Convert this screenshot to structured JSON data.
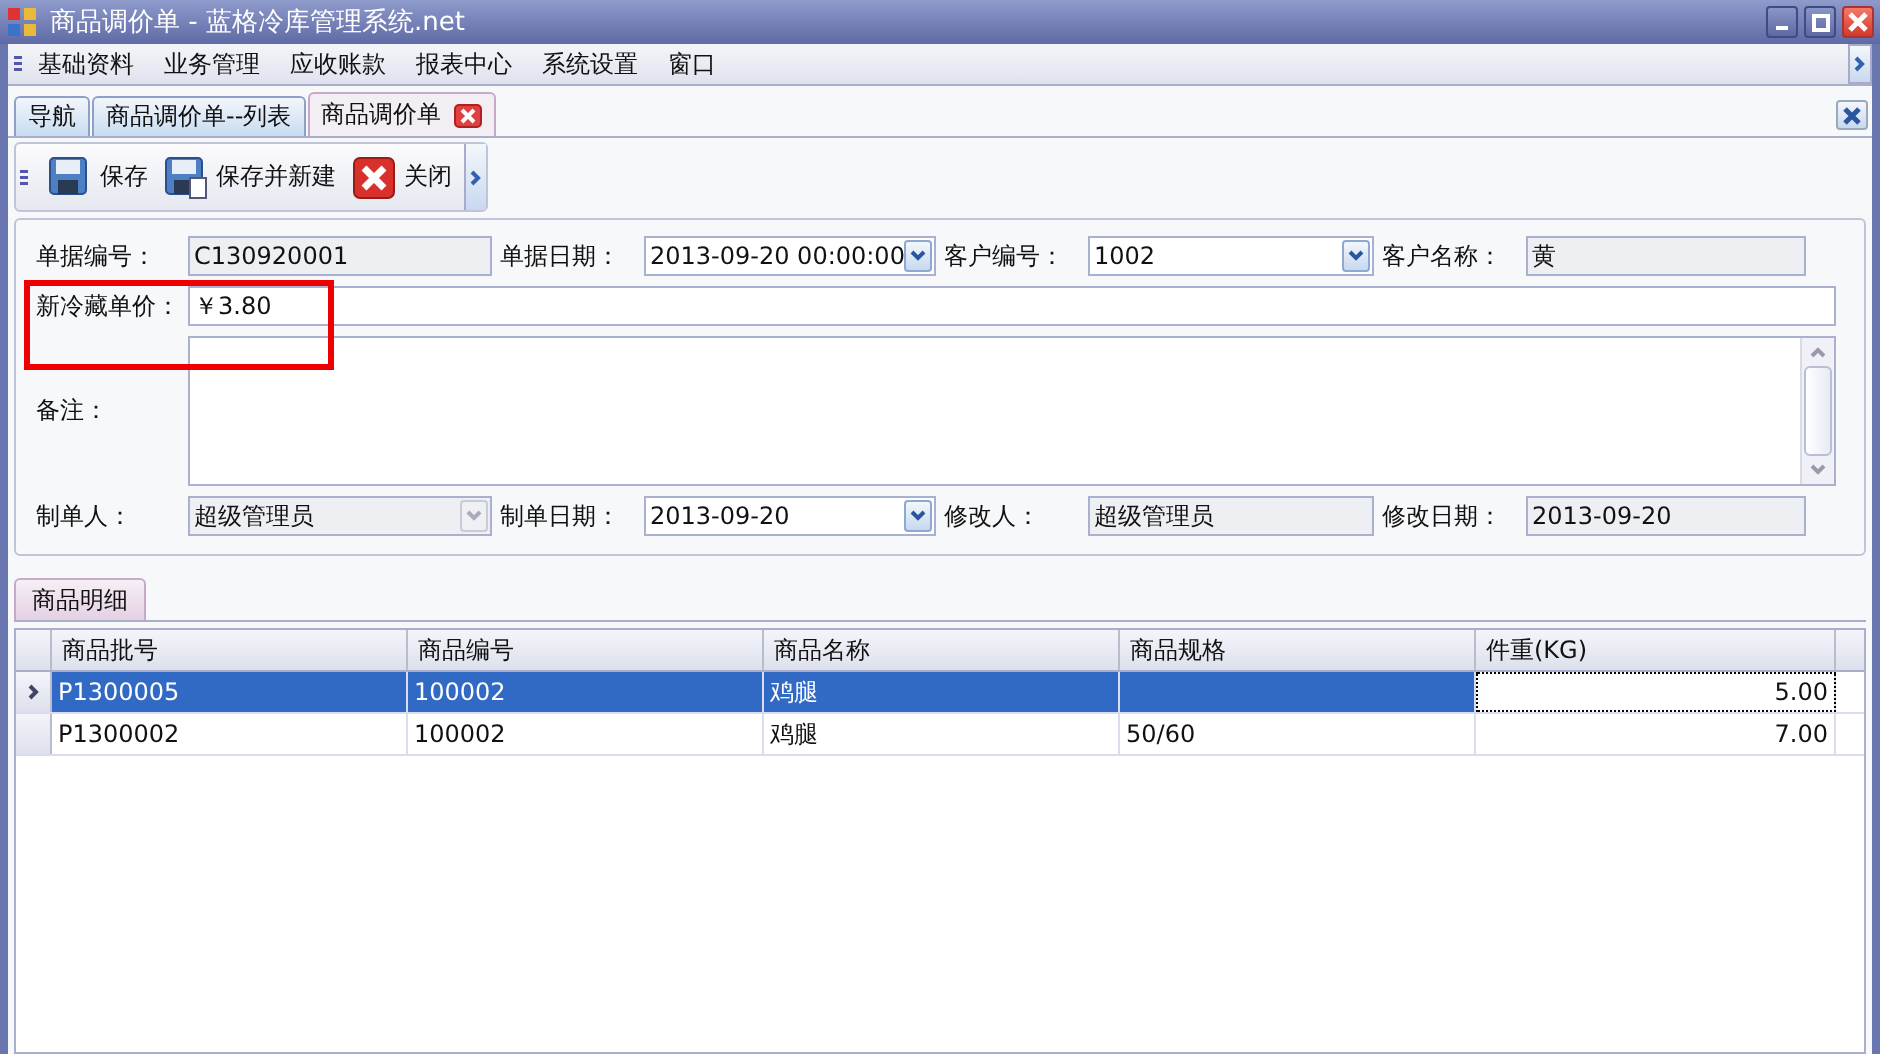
{
  "window": {
    "title": "商品调价单 - 蓝格冷库管理系统.net"
  },
  "menu": [
    "基础资料",
    "业务管理",
    "应收账款",
    "报表中心",
    "系统设置",
    "窗口"
  ],
  "doc_tabs": [
    {
      "label": "导航",
      "selected": false,
      "closable": false
    },
    {
      "label": "商品调价单--列表",
      "selected": false,
      "closable": false
    },
    {
      "label": "商品调价单",
      "selected": true,
      "closable": true
    }
  ],
  "toolbar": [
    {
      "label": "保存",
      "kind": "save"
    },
    {
      "label": "保存并新建",
      "kind": "save_new"
    },
    {
      "label": "关闭",
      "kind": "close"
    }
  ],
  "form": {
    "row1": [
      {
        "label": "单据编号：",
        "value": "C130920001",
        "kind": "text",
        "disabled": true
      },
      {
        "label": "单据日期：",
        "value": "2013-09-20  00:00:00",
        "kind": "combo",
        "disabled": false
      },
      {
        "label": "客户编号：",
        "value": "1002",
        "kind": "combo",
        "disabled": false
      },
      {
        "label": "客户名称：",
        "value": "黄",
        "kind": "text",
        "disabled": true
      }
    ],
    "price": {
      "label": "新冷藏单价：",
      "value": "￥3.80"
    },
    "memo": {
      "label": "备注："
    },
    "row4": [
      {
        "label": "制单人：",
        "value": "超级管理员",
        "kind": "combo",
        "disabled": true
      },
      {
        "label": "制单日期：",
        "value": "2013-09-20",
        "kind": "combo",
        "disabled": false
      },
      {
        "label": "修改人：",
        "value": "超级管理员",
        "kind": "text",
        "disabled": true
      },
      {
        "label": "修改日期：",
        "value": "2013-09-20",
        "kind": "text",
        "disabled": true
      }
    ]
  },
  "detail_tab": {
    "label": "商品明细"
  },
  "table": {
    "columns": [
      {
        "label": "商品批号",
        "kind": "text"
      },
      {
        "label": "商品编号",
        "kind": "text"
      },
      {
        "label": "商品名称",
        "kind": "text"
      },
      {
        "label": "商品规格",
        "kind": "text"
      },
      {
        "label": "件重(KG)",
        "kind": "number"
      }
    ],
    "rows": [
      {
        "selected": true,
        "cells": [
          {
            "text": "P1300005",
            "focused": false
          },
          {
            "text": "100002",
            "focused": false
          },
          {
            "text": "鸡腿",
            "focused": false
          },
          {
            "focused": false
          },
          {
            "text": "5.00",
            "focused": true
          }
        ]
      },
      {
        "selected": false,
        "cells": [
          {
            "text": "P1300002",
            "focused": false
          },
          {
            "text": "100002",
            "focused": false
          },
          {
            "text": "鸡腿",
            "focused": false
          },
          {
            "text": "50/60",
            "focused": false
          },
          {
            "text": "7.00",
            "focused": false
          }
        ]
      }
    ]
  }
}
